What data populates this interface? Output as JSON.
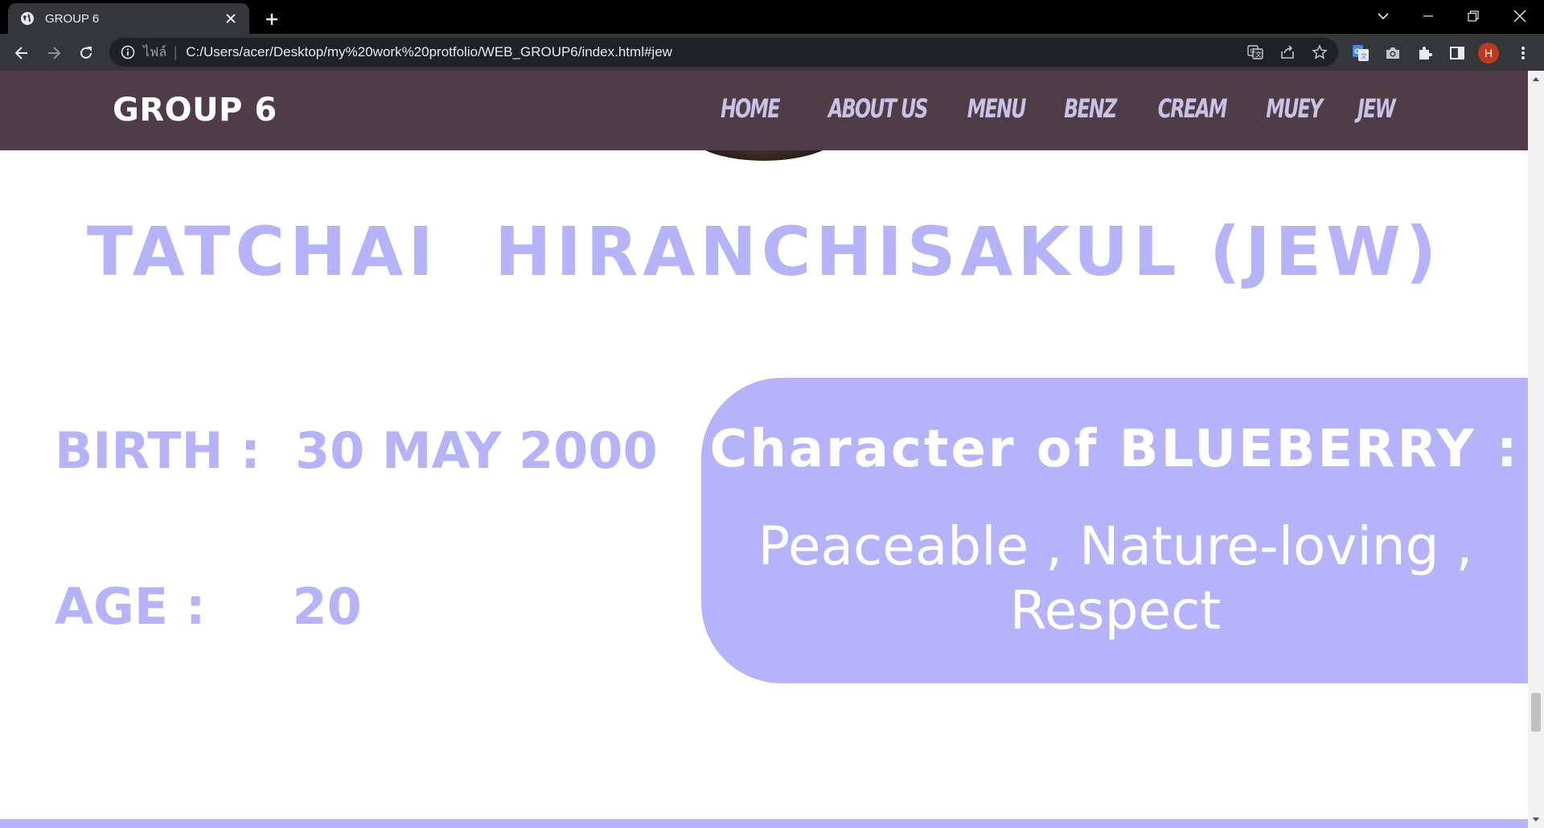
{
  "browser": {
    "tab": {
      "title": "GROUP 6"
    },
    "omnibox": {
      "scheme_label": "ไฟล์",
      "separator": "|",
      "url": "C:/Users/acer/Desktop/my%20work%20protfolio/WEB_GROUP6/index.html#jew"
    },
    "profile": {
      "initial": "H",
      "color": "#c0391b"
    }
  },
  "site": {
    "brand": "GROUP 6",
    "nav": [
      {
        "label": "HOME"
      },
      {
        "label": "ABOUT US"
      },
      {
        "label": "MENU"
      },
      {
        "label": "BENZ"
      },
      {
        "label": "CREAM"
      },
      {
        "label": "MUEY"
      },
      {
        "label": "JEW"
      }
    ],
    "colors": {
      "header_bg": "#4f3c47",
      "accent": "#b7b3fb",
      "nav_text": "#c7c3e6"
    }
  },
  "profile": {
    "name": "TATCHAI  HIRANCHISAKUL (JEW)",
    "birth": "BIRTH :  30 MAY 2000",
    "age": "AGE :     20",
    "character_heading": "Character of BLUEBERRY :",
    "character_traits": "Peaceable , Nature-loving  , Respect"
  }
}
